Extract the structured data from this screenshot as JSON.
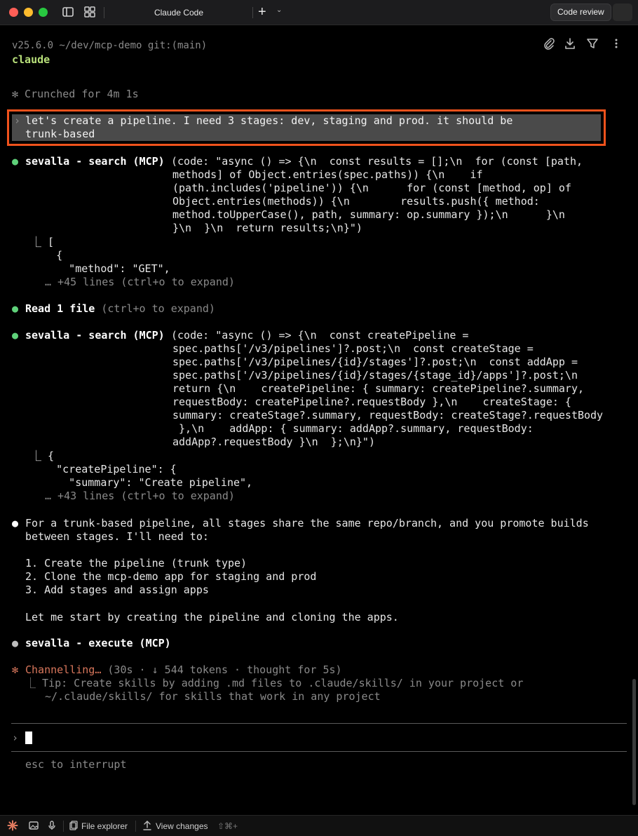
{
  "window": {
    "tab_title": "Claude Code",
    "new_tab": "+",
    "tab_menu": "⌄",
    "code_review_label": "Code review"
  },
  "terminal": {
    "prompt_path": "v25.6.0 ~/dev/mcp-demo git:(main)",
    "command": "claude",
    "status_crunched": "✻ Crunched for 4m 1s",
    "user_message_line1": "let's create a pipeline. I need 3 stages: dev, staging and prod. it should be",
    "user_message_line2": "trunk-based",
    "tool1": {
      "name": "sevalla - search (MCP)",
      "args": [
        "(code: \"async () => {\\n  const results = [];\\n  for (const [path,",
        "methods] of Object.entries(spec.paths)) {\\n    if",
        "(path.includes('pipeline')) {\\n      for (const [method, op] of",
        "Object.entries(methods)) {\\n        results.push({ method:",
        "method.toUpperCase(), path, summary: op.summary });\\n      }\\n",
        "}\\n  }\\n  return results;\\n}\")"
      ],
      "result": [
        "⎿ [",
        "    {",
        "      \"method\": \"GET\","
      ],
      "more": "… +45 lines (ctrl+o to expand)"
    },
    "read_label": "Read",
    "read_count": "1",
    "read_unit": "file",
    "read_hint": "(ctrl+o to expand)",
    "tool2": {
      "name": "sevalla - search (MCP)",
      "args": [
        "(code: \"async () => {\\n  const createPipeline =",
        "spec.paths['/v3/pipelines']?.post;\\n  const createStage =",
        "spec.paths['/v3/pipelines/{id}/stages']?.post;\\n  const addApp =",
        "spec.paths['/v3/pipelines/{id}/stages/{stage_id}/apps']?.post;\\n",
        "return {\\n    createPipeline: { summary: createPipeline?.summary,",
        "requestBody: createPipeline?.requestBody },\\n    createStage: {",
        "summary: createStage?.summary, requestBody: createStage?.requestBody",
        " },\\n    addApp: { summary: addApp?.summary, requestBody:",
        "addApp?.requestBody }\\n  };\\n}\")"
      ],
      "result": [
        "⎿ {",
        "    \"createPipeline\": {",
        "      \"summary\": \"Create pipeline\","
      ],
      "more": "… +43 lines (ctrl+o to expand)"
    },
    "assistant": {
      "line1": "For a trunk-based pipeline, all stages share the same repo/branch, and you promote builds",
      "line2": "between stages. I'll need to:",
      "steps": [
        "1. Create the pipeline (trunk type)",
        "2. Clone the mcp-demo app for staging and prod",
        "3. Add stages and assign apps"
      ],
      "closing": "Let me start by creating the pipeline and cloning the apps."
    },
    "tool3_name": "sevalla - execute (MCP)",
    "spinner": "✻",
    "channelling": "Channelling…",
    "channelling_meta": "(30s · ↓ 544 tokens · thought for 5s)",
    "tip_line1": "⎿ Tip: Create skills by adding .md files to .claude/skills/ in your project or",
    "tip_line2": "~/.claude/skills/ for skills that work in any project",
    "input_prompt": "›",
    "interrupt_hint": "esc to interrupt"
  },
  "bottombar": {
    "file_explorer": "File explorer",
    "view_changes": "View changes",
    "view_changes_shortcut": "⇧⌘+"
  },
  "colors": {
    "highlight_border": "#f0521c",
    "bullet_green": "#5fd17a",
    "command_green": "#b8e07a",
    "channelling": "#d9775c"
  }
}
